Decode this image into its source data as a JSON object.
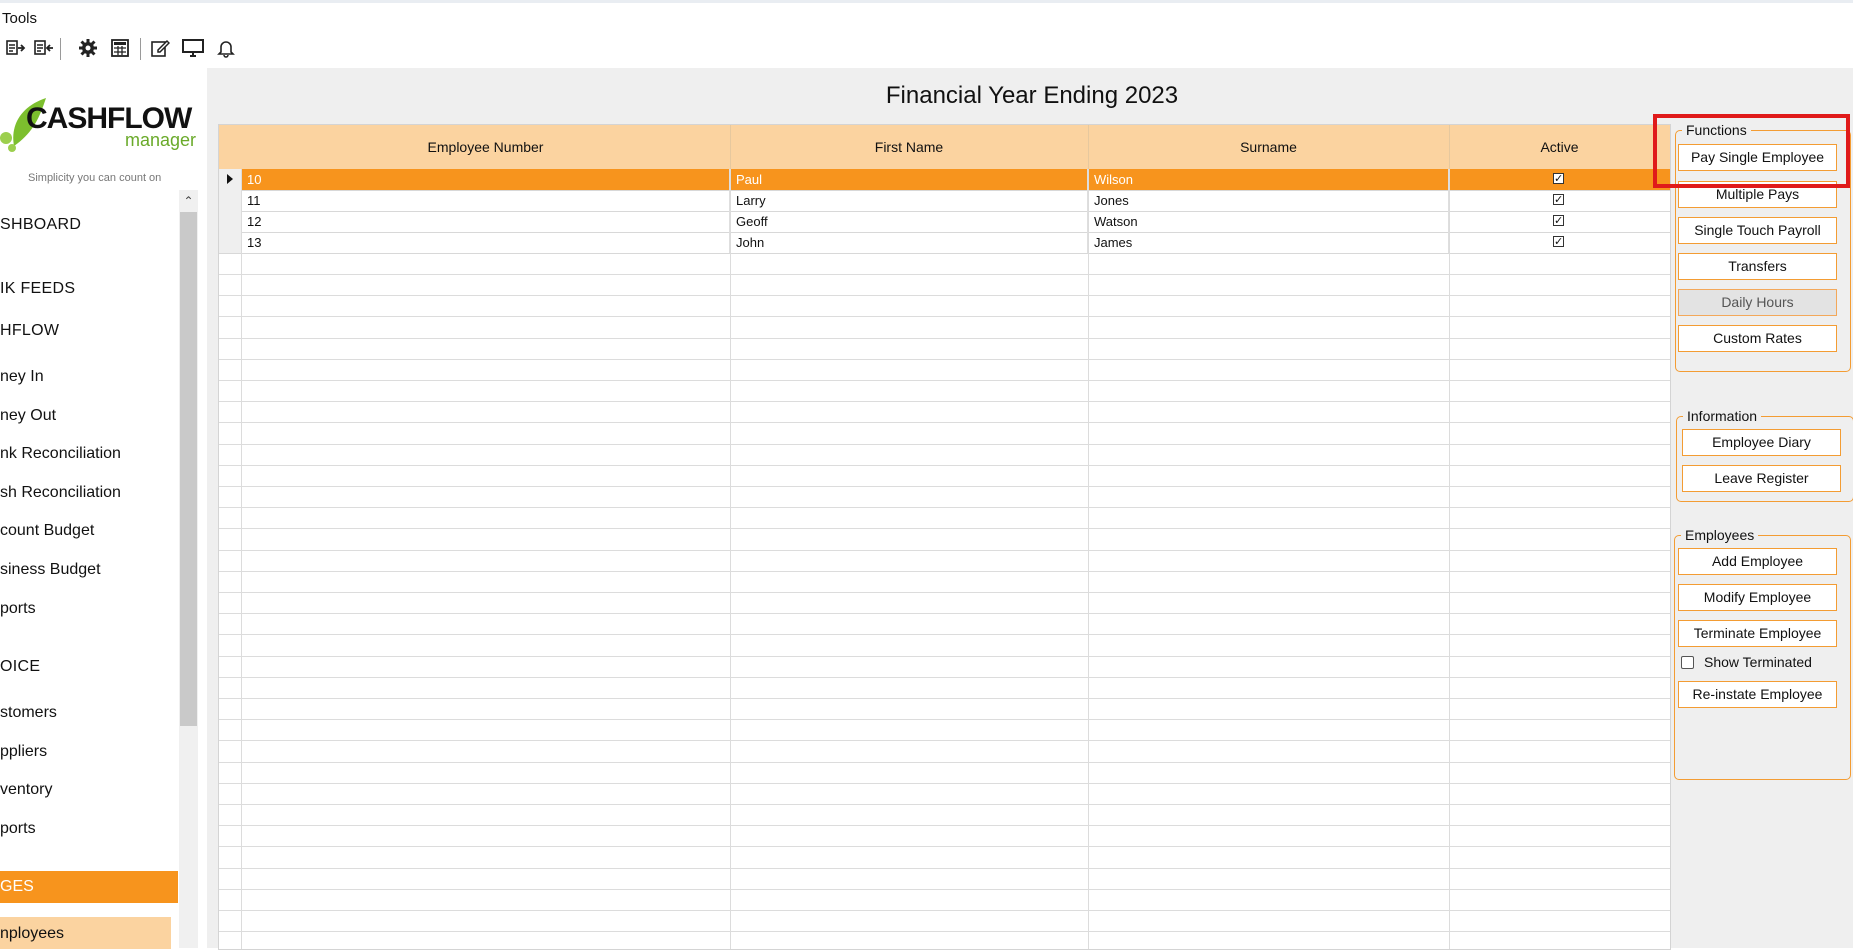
{
  "menu": {
    "tools_label": "Tools"
  },
  "toolbar": {
    "icons": [
      "export-icon",
      "import-icon",
      "gear-icon",
      "calculator-icon",
      "edit-icon",
      "monitor-icon",
      "bell-icon"
    ]
  },
  "logo": {
    "word": "CASHFLOW",
    "sub": "manager",
    "tagline": "Simplicity you can count on"
  },
  "sidebar": {
    "items": [
      "SHBOARD",
      "IK FEEDS",
      "HFLOW",
      "ney In",
      "ney Out",
      "nk Reconciliation",
      "sh Reconciliation",
      "count Budget",
      "siness Budget",
      "ports",
      "OICE",
      "stomers",
      "ppliers",
      "ventory",
      "ports",
      "GES",
      "nployees"
    ]
  },
  "main": {
    "title": "Financial Year Ending 2023",
    "columns": [
      "Employee Number",
      "First Name",
      "Surname",
      "Active"
    ],
    "rows": [
      {
        "number": "10",
        "first": "Paul",
        "surname": "Wilson",
        "active": true
      },
      {
        "number": "11",
        "first": "Larry",
        "surname": "Jones",
        "active": true
      },
      {
        "number": "12",
        "first": "Geoff",
        "surname": "Watson",
        "active": true
      },
      {
        "number": "13",
        "first": "John",
        "surname": "James",
        "active": true
      }
    ]
  },
  "panel": {
    "functions": {
      "title": "Functions",
      "buttons": [
        "Pay Single Employee",
        "Multiple Pays",
        "Single Touch Payroll",
        "Transfers",
        "Daily Hours",
        "Custom Rates"
      ]
    },
    "information": {
      "title": "Information",
      "buttons": [
        "Employee Diary",
        "Leave Register"
      ]
    },
    "employees": {
      "title": "Employees",
      "buttons": [
        "Add Employee",
        "Modify Employee",
        "Terminate Employee",
        "Re-instate Employee"
      ],
      "show_terminated_label": "Show Terminated"
    }
  },
  "colors": {
    "accent": "#f7941d",
    "header": "#fbd3a0",
    "highlight": "#e01a1a"
  }
}
